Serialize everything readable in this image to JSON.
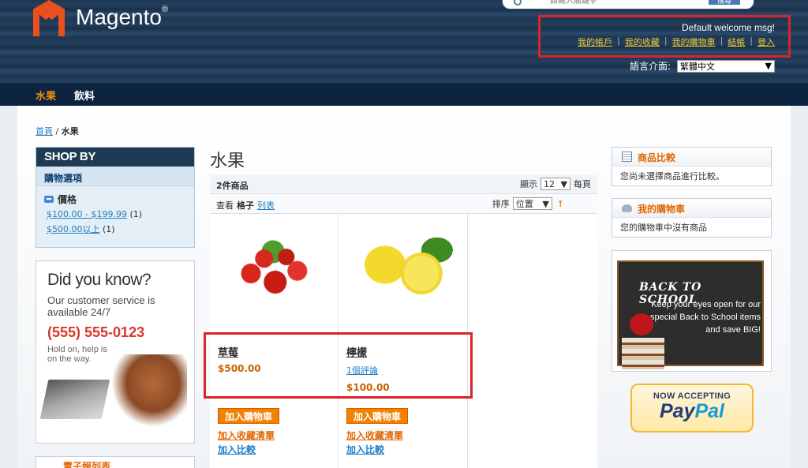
{
  "header": {
    "logo_text": "Magento",
    "logo_reg": "®",
    "search_placeholder": "請輸入關鍵字",
    "search_button": "搜尋",
    "welcome": "Default welcome msg!",
    "links": [
      "我的帳戶",
      "我的收藏",
      "我的購物車",
      "結帳",
      "登入"
    ],
    "lang_label": "語言介面:",
    "lang_value": "繁體中文"
  },
  "nav": {
    "items": [
      "水果",
      "飲料"
    ]
  },
  "breadcrumb": {
    "home": "首頁",
    "sep": "/",
    "current": "水果"
  },
  "shopby": {
    "title": "SHOP BY",
    "subtitle": "購物選項",
    "filter_name": "價格",
    "filters": [
      {
        "label": "$100.00 - $199.99",
        "count": "(1)"
      },
      {
        "label": "$500.00以上",
        "count": "(1)"
      }
    ]
  },
  "promo": {
    "headline": "Did you know?",
    "sub": "Our customer service is available 24/7",
    "phone": "(555) 555-0123",
    "tag": "Hold on, help is on the way."
  },
  "newsletter": {
    "title": "電子報列表"
  },
  "category": {
    "title": "水果",
    "amount": "2件商品",
    "show_label": "顯示",
    "limit": "12",
    "per_page": "每頁",
    "view_label": "查看",
    "view_grid": "格子",
    "view_list": "列表",
    "sort_label": "排序",
    "sort_value": "位置",
    "sort_dir_icon": "↑"
  },
  "products": [
    {
      "name": "草莓",
      "price": "$500.00",
      "review": "",
      "cart": "加入購物車",
      "wishlist": "加入收藏清單",
      "compare": "加入比較"
    },
    {
      "name": "檸檬",
      "price": "$100.00",
      "review": "1個評論",
      "cart": "加入購物車",
      "wishlist": "加入收藏清單",
      "compare": "加入比較"
    }
  ],
  "compare_box": {
    "title": "商品比較",
    "text": "您尚未選擇商品進行比較。"
  },
  "cart_box": {
    "title": "我的購物車",
    "text": "您的購物車中沒有商品"
  },
  "school": {
    "headline": "BACK TO SCHOOL",
    "text": "Keep your eyes open for our special Back to School items and save BIG!"
  },
  "paypal": {
    "now": "NOW ACCEPTING",
    "logo1": "Pay",
    "logo2": "Pal"
  }
}
